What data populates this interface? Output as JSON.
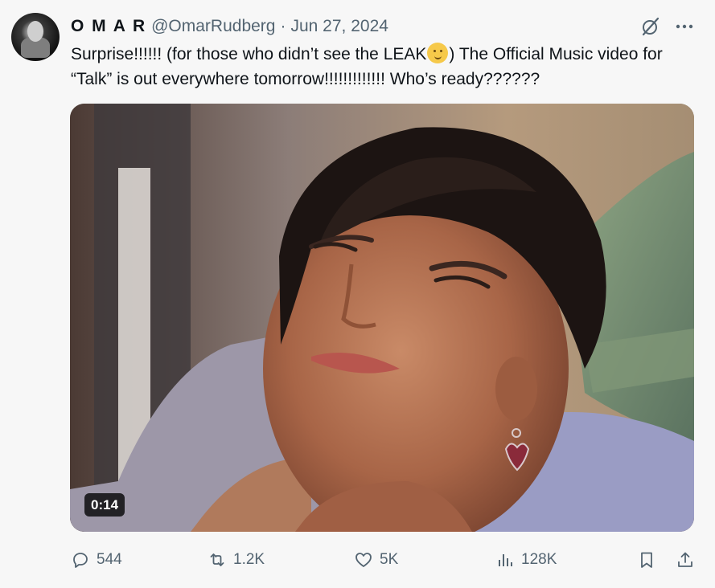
{
  "tweet": {
    "display_name": "O M A R",
    "handle": "@OmarRudberg",
    "separator": "·",
    "date": "Jun 27, 2024",
    "text_part1": "Surprise!!!!!! (for those who didn’t see the LEAK",
    "text_part2": ") The Official Music video for “Talk” is out everywhere tomorrow!!!!!!!!!!!!! Who’s ready??????",
    "emoji": "melting-face-emoji"
  },
  "media": {
    "duration": "0:14"
  },
  "actions": {
    "replies": "544",
    "reposts": "1.2K",
    "likes": "5K",
    "views": "128K"
  },
  "icons": {
    "reply": "reply-icon",
    "repost": "repost-icon",
    "like": "heart-icon",
    "views": "views-icon",
    "bookmark": "bookmark-icon",
    "share": "share-icon",
    "grok": "grok-icon",
    "more": "more-icon"
  },
  "colors": {
    "text": "#0f1419",
    "muted": "#536471",
    "background": "#f7f7f7"
  }
}
